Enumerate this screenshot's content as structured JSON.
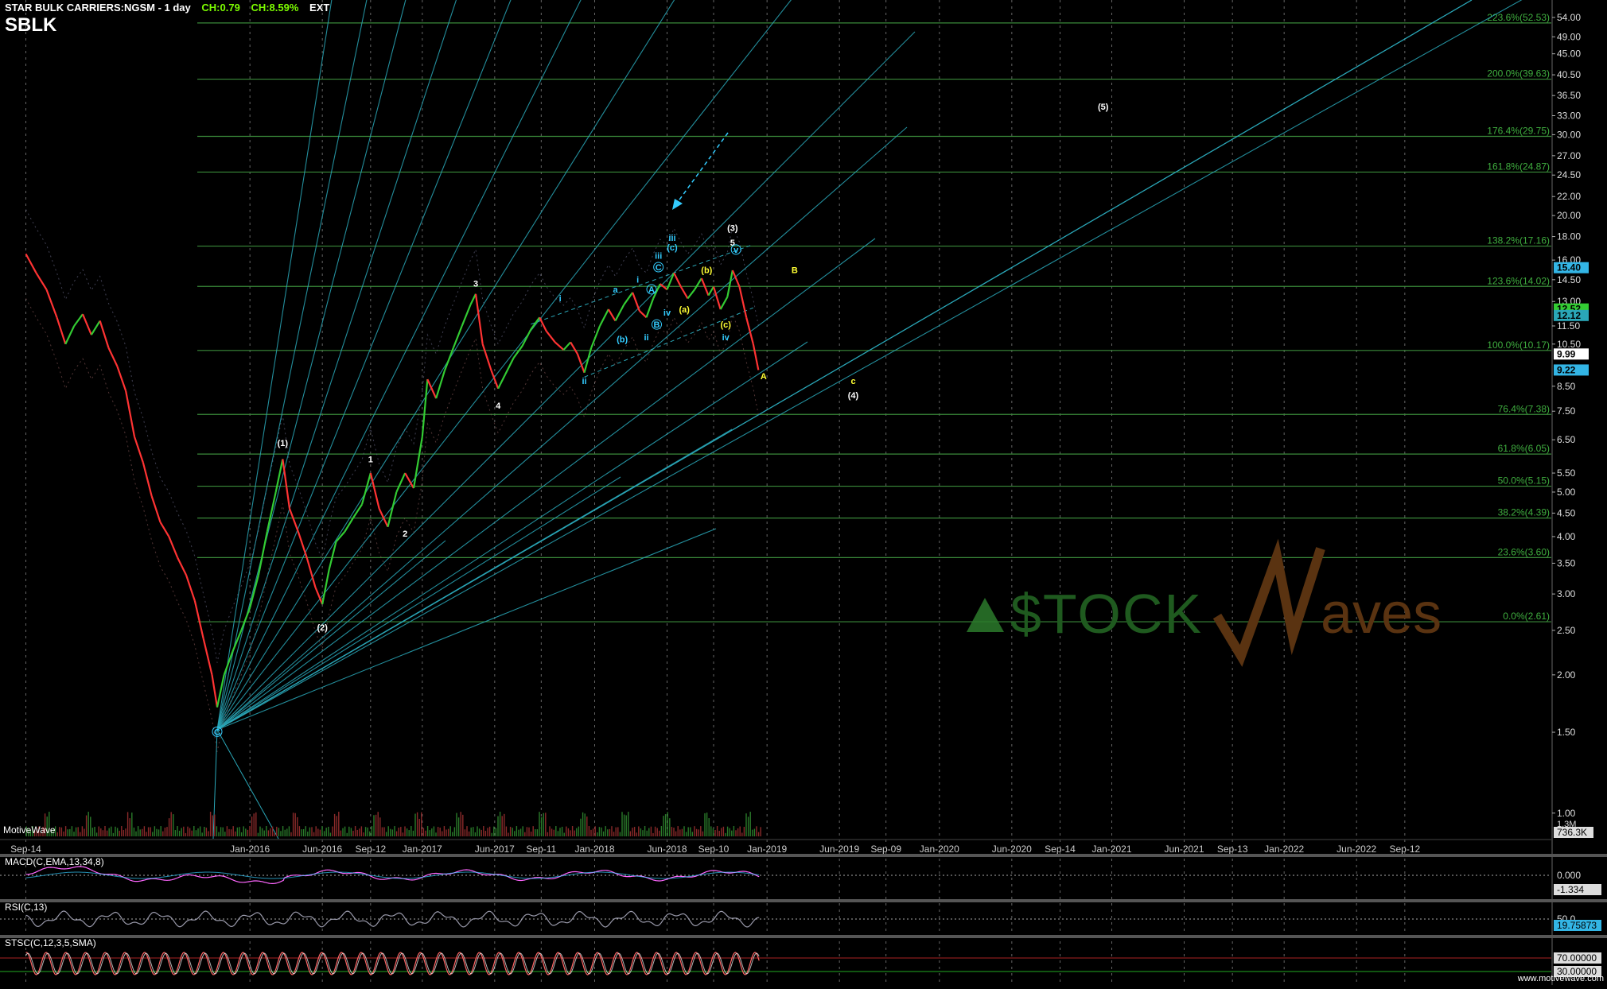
{
  "header": {
    "title": "STAR BULK CARRIERS:NGSM - 1 day",
    "change1": "CH:0.79",
    "change2": "CH:8.59%",
    "ext": "EXT",
    "symbol": "SBLK"
  },
  "source_label": "MotiveWave",
  "watermark": {
    "left": "$TOCK",
    "right": "aves"
  },
  "footer_credit": "www.motivewave.com",
  "colors": {
    "background": "#000000",
    "up": "#33cc33",
    "down": "#ff3333",
    "fib": "#3a8a3a",
    "fan": "#2aa7b8",
    "wave_white": "#ffffff",
    "wave_cyan": "#33ccff",
    "wave_yellow": "#ffff33"
  },
  "chart_data": [
    {
      "type": "line",
      "name": "price",
      "scale": "log",
      "ylim": [
        0.89,
        58
      ],
      "price_ticks": [
        "54.00",
        "49.00",
        "45.00",
        "40.50",
        "36.50",
        "33.00",
        "30.00",
        "27.00",
        "24.50",
        "22.00",
        "20.00",
        "18.00",
        "16.00",
        "14.50",
        "13.00",
        "11.50",
        "10.50",
        "8.50",
        "7.50",
        "6.50",
        "5.50",
        "5.00",
        "4.50",
        "4.00",
        "3.50",
        "3.00",
        "2.50",
        "2.00",
        "1.50",
        "1.00"
      ],
      "price_tick_values": [
        54,
        49,
        45,
        40.5,
        36.5,
        33,
        30,
        27,
        24.5,
        22,
        20,
        18,
        16,
        14.5,
        13,
        11.5,
        10.5,
        8.5,
        7.5,
        6.5,
        5.5,
        5.0,
        4.5,
        4.0,
        3.5,
        3.0,
        2.5,
        2.0,
        1.5,
        1.0
      ],
      "x_labels": [
        {
          "label": "Sep-14",
          "t": 2014.7
        },
        {
          "label": "Jan-2016",
          "t": 2016.0
        },
        {
          "label": "Jun-2016",
          "t": 2016.42
        },
        {
          "label": "Sep-12",
          "t": 2016.7
        },
        {
          "label": "Jan-2017",
          "t": 2017.0
        },
        {
          "label": "Jun-2017",
          "t": 2017.42
        },
        {
          "label": "Sep-11",
          "t": 2017.69
        },
        {
          "label": "Jan-2018",
          "t": 2018.0
        },
        {
          "label": "Jun-2018",
          "t": 2018.42
        },
        {
          "label": "Sep-10",
          "t": 2018.69
        },
        {
          "label": "Jan-2019",
          "t": 2019.0
        },
        {
          "label": "Jun-2019",
          "t": 2019.42
        },
        {
          "label": "Sep-09",
          "t": 2019.69
        },
        {
          "label": "Jan-2020",
          "t": 2020.0
        },
        {
          "label": "Jun-2020",
          "t": 2020.42
        },
        {
          "label": "Sep-14",
          "t": 2020.7
        },
        {
          "label": "Jan-2021",
          "t": 2021.0
        },
        {
          "label": "Jun-2021",
          "t": 2021.42
        },
        {
          "label": "Sep-13",
          "t": 2021.7
        },
        {
          "label": "Jan-2022",
          "t": 2022.0
        },
        {
          "label": "Jun-2022",
          "t": 2022.42
        },
        {
          "label": "Sep-12",
          "t": 2022.7
        }
      ],
      "price_series": [
        [
          2014.7,
          16.5
        ],
        [
          2014.76,
          15.0
        ],
        [
          2014.82,
          13.8
        ],
        [
          2014.88,
          12.0
        ],
        [
          2014.93,
          10.5
        ],
        [
          2014.98,
          11.5
        ],
        [
          2015.03,
          12.2
        ],
        [
          2015.08,
          11.0
        ],
        [
          2015.13,
          11.8
        ],
        [
          2015.18,
          10.3
        ],
        [
          2015.23,
          9.4
        ],
        [
          2015.28,
          8.3
        ],
        [
          2015.33,
          6.6
        ],
        [
          2015.38,
          5.8
        ],
        [
          2015.43,
          4.9
        ],
        [
          2015.48,
          4.3
        ],
        [
          2015.53,
          4.0
        ],
        [
          2015.58,
          3.6
        ],
        [
          2015.63,
          3.3
        ],
        [
          2015.68,
          2.9
        ],
        [
          2015.73,
          2.4
        ],
        [
          2015.78,
          2.0
        ],
        [
          2015.81,
          1.7
        ],
        [
          2015.85,
          2.0
        ],
        [
          2015.9,
          2.25
        ],
        [
          2015.95,
          2.5
        ],
        [
          2016.0,
          2.8
        ],
        [
          2016.05,
          3.3
        ],
        [
          2016.1,
          4.1
        ],
        [
          2016.15,
          5.0
        ],
        [
          2016.19,
          5.9
        ],
        [
          2016.23,
          4.6
        ],
        [
          2016.28,
          4.1
        ],
        [
          2016.33,
          3.6
        ],
        [
          2016.38,
          3.1
        ],
        [
          2016.42,
          2.85
        ],
        [
          2016.46,
          3.4
        ],
        [
          2016.5,
          3.9
        ],
        [
          2016.55,
          4.1
        ],
        [
          2016.6,
          4.4
        ],
        [
          2016.65,
          4.7
        ],
        [
          2016.7,
          5.5
        ],
        [
          2016.75,
          4.6
        ],
        [
          2016.8,
          4.2
        ],
        [
          2016.85,
          5.0
        ],
        [
          2016.9,
          5.5
        ],
        [
          2016.95,
          5.1
        ],
        [
          2017.0,
          6.6
        ],
        [
          2017.03,
          8.8
        ],
        [
          2017.08,
          8.0
        ],
        [
          2017.13,
          9.2
        ],
        [
          2017.18,
          10.3
        ],
        [
          2017.23,
          11.5
        ],
        [
          2017.28,
          12.8
        ],
        [
          2017.31,
          13.5
        ],
        [
          2017.35,
          10.5
        ],
        [
          2017.4,
          9.2
        ],
        [
          2017.44,
          8.4
        ],
        [
          2017.48,
          9.0
        ],
        [
          2017.53,
          9.8
        ],
        [
          2017.58,
          10.4
        ],
        [
          2017.63,
          11.3
        ],
        [
          2017.68,
          12.0
        ],
        [
          2017.72,
          11.2
        ],
        [
          2017.77,
          10.6
        ],
        [
          2017.82,
          10.2
        ],
        [
          2017.86,
          10.6
        ],
        [
          2017.9,
          10.0
        ],
        [
          2017.94,
          9.1
        ],
        [
          2017.98,
          10.3
        ],
        [
          2018.03,
          11.5
        ],
        [
          2018.08,
          12.5
        ],
        [
          2018.12,
          11.8
        ],
        [
          2018.17,
          12.8
        ],
        [
          2018.22,
          13.6
        ],
        [
          2018.26,
          12.4
        ],
        [
          2018.3,
          12.0
        ],
        [
          2018.34,
          13.2
        ],
        [
          2018.38,
          14.2
        ],
        [
          2018.42,
          13.8
        ],
        [
          2018.46,
          15.0
        ],
        [
          2018.5,
          14.0
        ],
        [
          2018.54,
          13.2
        ],
        [
          2018.58,
          13.8
        ],
        [
          2018.62,
          14.6
        ],
        [
          2018.66,
          13.4
        ],
        [
          2018.69,
          14.0
        ],
        [
          2018.73,
          12.5
        ],
        [
          2018.77,
          13.3
        ],
        [
          2018.8,
          15.2
        ],
        [
          2018.84,
          14.0
        ],
        [
          2018.88,
          12.0
        ],
        [
          2018.92,
          10.5
        ],
        [
          2018.95,
          9.22
        ]
      ],
      "fib_levels": [
        {
          "label": "223.6%(52.53)",
          "price": 52.53
        },
        {
          "label": "200.0%(39.63)",
          "price": 39.63
        },
        {
          "label": "176.4%(29.75)",
          "price": 29.75
        },
        {
          "label": "161.8%(24.87)",
          "price": 24.87
        },
        {
          "label": "138.2%(17.16)",
          "price": 17.16
        },
        {
          "label": "123.6%(14.02)",
          "price": 14.02
        },
        {
          "label": "100.0%(10.17)",
          "price": 10.17
        },
        {
          "label": "76.4%(7.38)",
          "price": 7.38
        },
        {
          "label": "61.8%(6.05)",
          "price": 6.05
        },
        {
          "label": "50.0%(5.15)",
          "price": 5.15
        },
        {
          "label": "38.2%(4.39)",
          "price": 4.39
        },
        {
          "label": "23.6%(3.60)",
          "price": 3.6
        },
        {
          "label": "0.0%(2.61)",
          "price": 2.61
        }
      ],
      "price_badges": [
        {
          "label": "15.40",
          "price": 15.4,
          "color": "#33b5e5"
        },
        {
          "label": "12.52",
          "price": 12.52,
          "color": "#33cc33"
        },
        {
          "label": "12.12",
          "price": 12.12,
          "color": "#2aa7b8"
        },
        {
          "label": "9.99",
          "price": 9.99,
          "color": "#ffffff"
        },
        {
          "label": "9.22",
          "price": 9.22,
          "color": "#33b5e5"
        }
      ],
      "volume_badge": {
        "label": "736.3K"
      },
      "volume_top_label": "1.3M",
      "wave_labels": [
        {
          "text": "(1)",
          "t": 2016.19,
          "price": 6.3,
          "color": "#ffffff"
        },
        {
          "text": "(2)",
          "t": 2016.42,
          "price": 2.5,
          "color": "#ffffff"
        },
        {
          "text": "1",
          "t": 2016.7,
          "price": 5.8,
          "color": "#ffffff"
        },
        {
          "text": "2",
          "t": 2016.9,
          "price": 4.0,
          "color": "#ffffff"
        },
        {
          "text": "3",
          "t": 2017.31,
          "price": 14.0,
          "color": "#ffffff"
        },
        {
          "text": "4",
          "t": 2017.44,
          "price": 7.6,
          "color": "#ffffff"
        },
        {
          "text": "(3)",
          "t": 2018.8,
          "price": 18.5,
          "color": "#ffffff"
        },
        {
          "text": "5",
          "t": 2018.8,
          "price": 17.2,
          "color": "#ffffff"
        },
        {
          "text": "(4)",
          "t": 2019.5,
          "price": 8.0,
          "color": "#ffffff"
        },
        {
          "text": "(5)",
          "t": 2020.95,
          "price": 34.0,
          "color": "#ffffff"
        },
        {
          "text": "c",
          "t": 2019.5,
          "price": 8.6,
          "color": "#ffff33"
        },
        {
          "text": "B",
          "t": 2019.16,
          "price": 15.0,
          "color": "#ffff33"
        },
        {
          "text": "A",
          "t": 2018.98,
          "price": 8.8,
          "color": "#ffff33"
        },
        {
          "text": "(a)",
          "t": 2018.52,
          "price": 12.3,
          "color": "#ffff33"
        },
        {
          "text": "(b)",
          "t": 2018.65,
          "price": 15.0,
          "color": "#ffff33"
        },
        {
          "text": "(c)",
          "t": 2018.76,
          "price": 11.4,
          "color": "#ffff33"
        },
        {
          "text": "C",
          "t": 2015.81,
          "price": 1.48,
          "color": "#33ccff"
        },
        {
          "text": "i",
          "t": 2017.8,
          "price": 13.0,
          "color": "#33ccff"
        },
        {
          "text": "ii",
          "t": 2017.94,
          "price": 8.6,
          "color": "#33ccff"
        },
        {
          "text": "a",
          "t": 2018.12,
          "price": 13.6,
          "color": "#33ccff"
        },
        {
          "text": "(b)",
          "t": 2018.16,
          "price": 10.6,
          "color": "#33ccff"
        },
        {
          "text": "i",
          "t": 2018.25,
          "price": 14.3,
          "color": "#33ccff"
        },
        {
          "text": "A",
          "t": 2018.33,
          "price": 13.6,
          "color": "#33ccff"
        },
        {
          "text": "ii",
          "t": 2018.3,
          "price": 10.7,
          "color": "#33ccff"
        },
        {
          "text": "B",
          "t": 2018.36,
          "price": 11.4,
          "color": "#33ccff"
        },
        {
          "text": "C",
          "t": 2018.37,
          "price": 15.2,
          "color": "#33ccff"
        },
        {
          "text": "iii",
          "t": 2018.37,
          "price": 16.1,
          "color": "#33ccff"
        },
        {
          "text": "iv",
          "t": 2018.42,
          "price": 12.1,
          "color": "#33ccff"
        },
        {
          "text": "(c)",
          "t": 2018.45,
          "price": 16.8,
          "color": "#33ccff"
        },
        {
          "text": "iii",
          "t": 2018.45,
          "price": 17.6,
          "color": "#33ccff"
        },
        {
          "text": "iv",
          "t": 2018.76,
          "price": 10.7,
          "color": "#33ccff"
        },
        {
          "text": "v",
          "t": 2018.82,
          "price": 16.6,
          "color": "#33ccff"
        }
      ]
    },
    {
      "type": "line",
      "name": "MACD",
      "title": "MACD(C,EMA,13,34,8)",
      "ticks": [
        "0.000",
        "-1.334"
      ]
    },
    {
      "type": "line",
      "name": "RSI",
      "title": "RSI(C,13)",
      "ticks": [
        "50.0",
        "19.75873"
      ]
    },
    {
      "type": "line",
      "name": "STSC",
      "title": "STSC(C,12,3,5,SMA)",
      "ticks": [
        "70.00000",
        "30.00000"
      ]
    }
  ]
}
